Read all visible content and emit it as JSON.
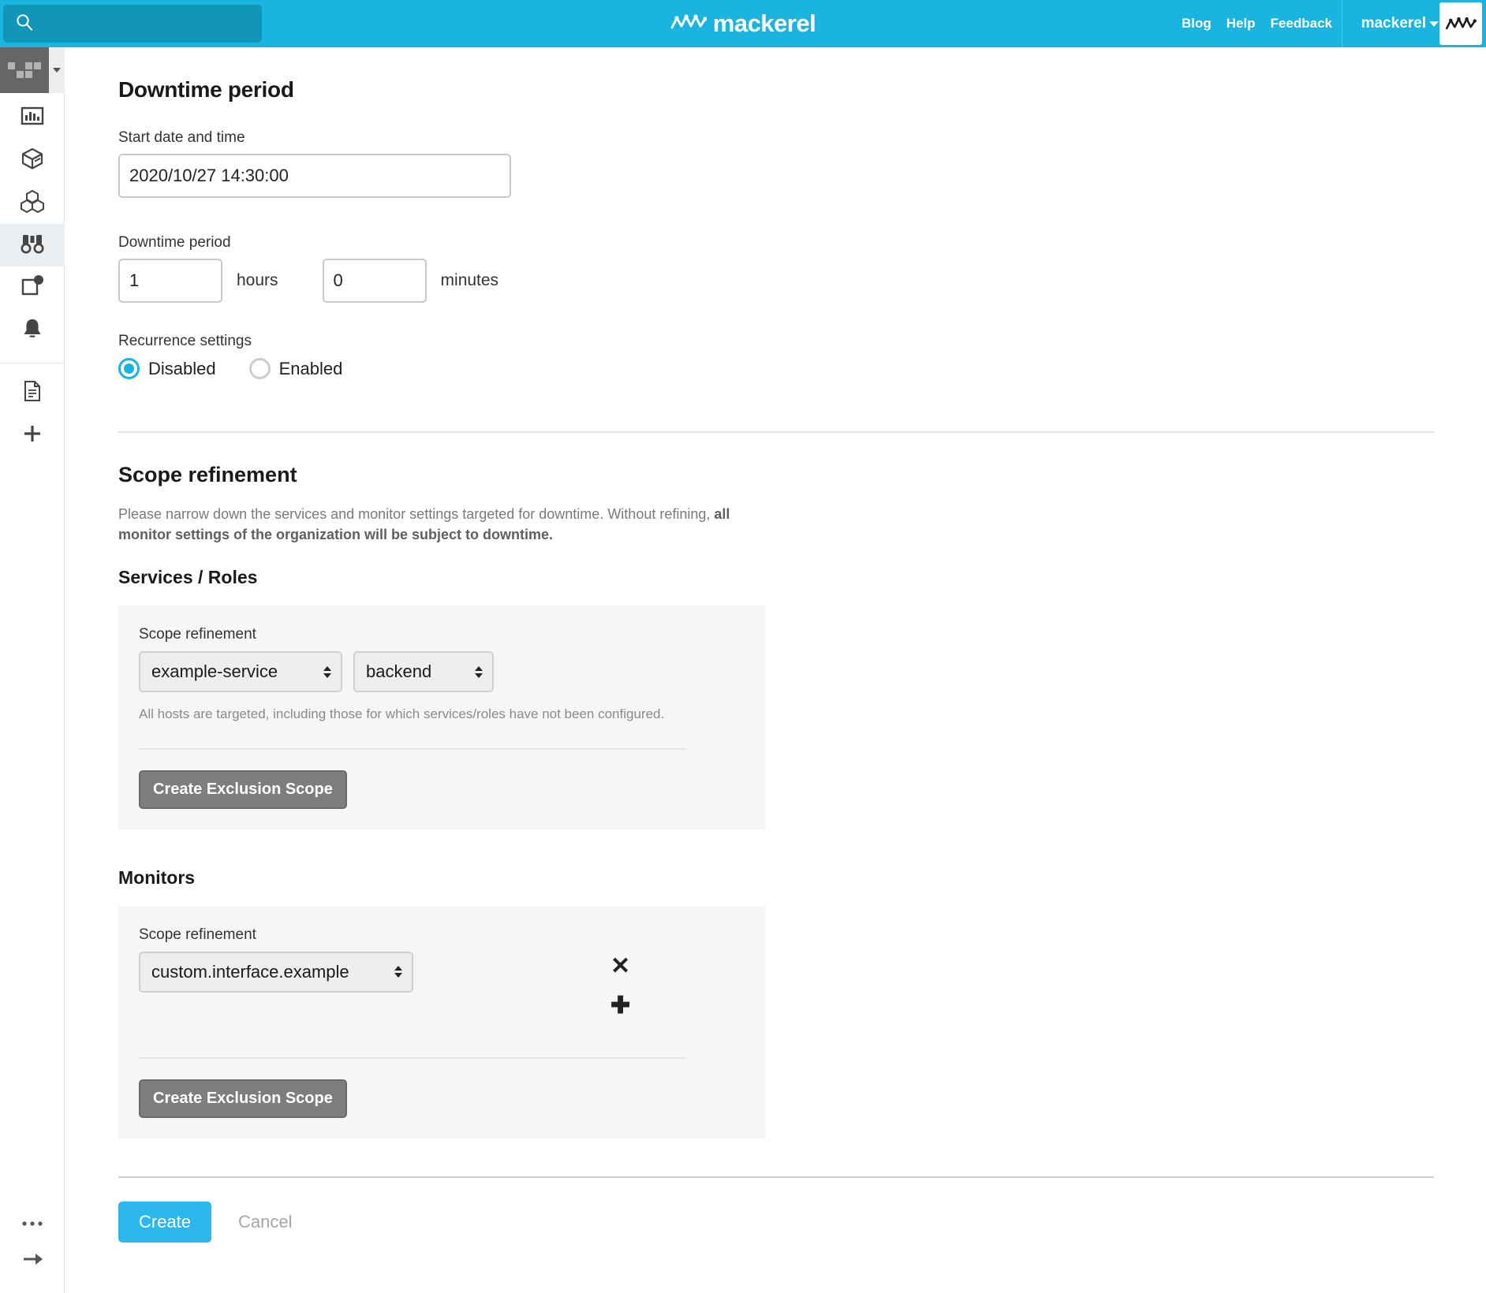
{
  "header": {
    "brand": "mackerel",
    "brand_logo_icon": "mackerel-logo-icon",
    "search": {
      "value": "",
      "placeholder": "",
      "icon": "search-icon"
    },
    "links": [
      {
        "label": "Blog"
      },
      {
        "label": "Help"
      },
      {
        "label": "Feedback"
      }
    ],
    "org_menu_label": "mackerel",
    "avatar_icon": "mackerel-logo-icon"
  },
  "sidebar": {
    "org_avatar_name": "org-avatar",
    "org_caret_icon": "chevron-down-icon",
    "items": [
      {
        "name": "dashboards",
        "icon": "bar-chart-icon",
        "active": false
      },
      {
        "name": "services",
        "icon": "cube-icon",
        "active": false
      },
      {
        "name": "hosts",
        "icon": "cubes-icon",
        "active": false
      },
      {
        "name": "monitors",
        "icon": "binoculars-icon",
        "active": true
      },
      {
        "name": "alerts",
        "icon": "alert-flag-icon",
        "active": false
      },
      {
        "name": "notifications",
        "icon": "bell-icon",
        "active": false
      }
    ],
    "secondary_items": [
      {
        "name": "docs",
        "icon": "document-icon"
      },
      {
        "name": "create",
        "icon": "plus-icon"
      }
    ],
    "bottom_items": [
      {
        "name": "more",
        "icon": "ellipsis-icon"
      },
      {
        "name": "expand-sidebar",
        "icon": "arrow-right-icon"
      }
    ]
  },
  "downtime": {
    "title": "Downtime period",
    "start_label": "Start date and time",
    "start_value": "2020/10/27 14:30:00",
    "period_label": "Downtime period",
    "hours_value": "1",
    "hours_unit": "hours",
    "minutes_value": "0",
    "minutes_unit": "minutes",
    "recurrence_label": "Recurrence settings",
    "recurrence_options": [
      {
        "label": "Disabled",
        "selected": true
      },
      {
        "label": "Enabled",
        "selected": false
      }
    ]
  },
  "scope": {
    "title": "Scope refinement",
    "description_plain_1": "Please narrow down the services and monitor settings targeted for downtime. Without refining, ",
    "description_bold": "all monitor settings of the organization will be subject to downtime.",
    "services_group_title": "Services / Roles",
    "services_panel": {
      "label": "Scope refinement",
      "service_select": "example-service",
      "role_select": "backend",
      "hint": "All hosts are targeted, including those for which services/roles have not been configured.",
      "exclusion_button": "Create Exclusion Scope"
    },
    "monitors_group_title": "Monitors",
    "monitors_panel": {
      "label": "Scope refinement",
      "monitor_select": "custom.interface.example",
      "remove_icon": "close-icon",
      "add_icon": "plus-icon",
      "exclusion_button": "Create Exclusion Scope"
    }
  },
  "footer": {
    "create_label": "Create",
    "cancel_label": "Cancel"
  },
  "colors": {
    "brand": "#19b5e0",
    "primary_button": "#2cb8ec",
    "panel_bg": "#f5f6f8",
    "grey_button": "#7d7d7d"
  }
}
